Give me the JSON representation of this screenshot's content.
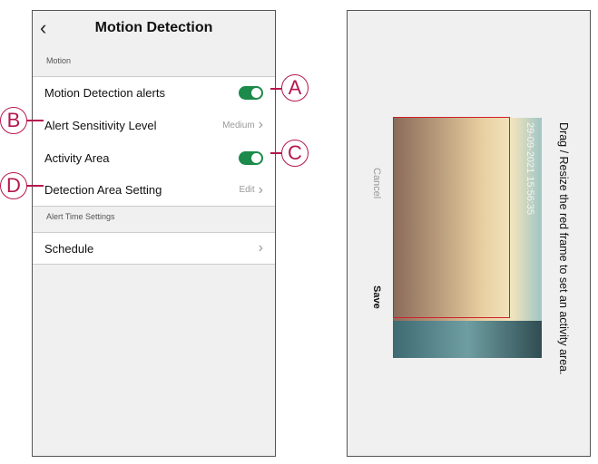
{
  "left": {
    "title": "Motion Detection",
    "sections": {
      "motion": "Motion",
      "alert_time": "Alert Time Settings"
    },
    "rows": [
      {
        "label": "Motion Detection alerts",
        "toggle": true
      },
      {
        "label": "Alert Sensitivity Level",
        "value": "Medium"
      },
      {
        "label": "Activity Area",
        "toggle": true
      },
      {
        "label": "Detection Area Setting",
        "value": "Edit"
      },
      {
        "label": "Schedule"
      }
    ]
  },
  "callouts": [
    "A",
    "B",
    "C",
    "D"
  ],
  "right": {
    "instruction": "Drag / Resize the red frame to set an activity area.",
    "timestamp": "29-09-2021 15:56:35",
    "cancel": "Cancel",
    "save": "Save"
  },
  "colors": {
    "toggle": "#1b8a4a",
    "callout": "#b5174f",
    "frame": "#d0202a"
  }
}
